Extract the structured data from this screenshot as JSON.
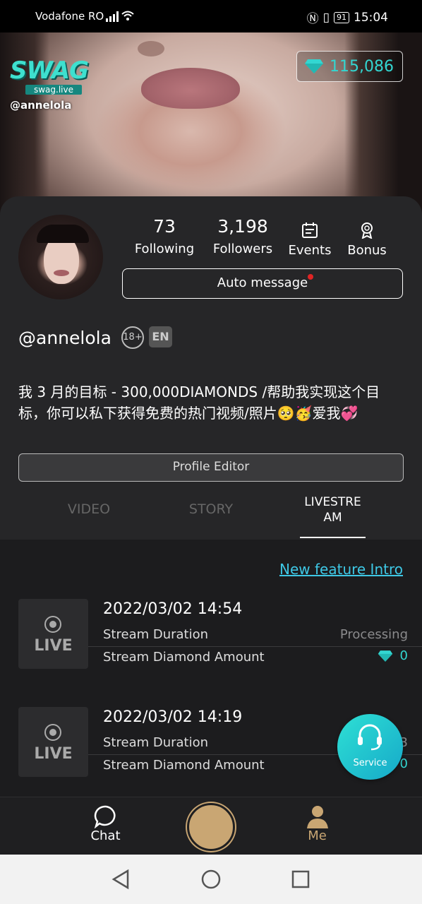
{
  "status_bar": {
    "carrier": "Vodafone RO",
    "battery": "91",
    "time": "15:04"
  },
  "hero": {
    "brand_logo": "SWAG",
    "brand_site": "swag.live",
    "handle": "@annelola",
    "diamond_balance": "115,086"
  },
  "profile": {
    "stats": [
      {
        "value": "73",
        "label": "Following"
      },
      {
        "value": "3,198",
        "label": "Followers"
      },
      {
        "value": "",
        "label": "Events",
        "icon": "calendar-icon"
      },
      {
        "value": "",
        "label": "Bonus",
        "icon": "badge-icon"
      }
    ],
    "auto_message_label": "Auto message",
    "username": "@annelola",
    "age_badge": "18+",
    "language_badge": "EN",
    "bio": "我 3 月的目标 - 300,000DIAMONDS /帮助我实现这个目标，你可以私下获得免费的热门视频/照片🥺🥳爱我💞",
    "profile_editor_label": "Profile Editor"
  },
  "tabs": [
    {
      "label": "VIDEO",
      "active": false
    },
    {
      "label": "STORY",
      "active": false
    },
    {
      "label": "LIVESTRE AM",
      "active": true
    }
  ],
  "list": {
    "feature_link": "New feature Intro",
    "streams": [
      {
        "tile_label": "LIVE",
        "date": "2022/03/02 14:54",
        "duration_label": "Stream Duration",
        "diamond_label": "Stream Diamond Amount",
        "status": "Processing",
        "diamonds": "0"
      },
      {
        "tile_label": "LIVE",
        "date": "2022/03/02 14:19",
        "duration_label": "Stream Duration",
        "diamond_label": "Stream Diamond Amount",
        "status": "3",
        "diamonds": "0"
      }
    ]
  },
  "service_label": "Service",
  "bottom_nav": {
    "chat_label": "Chat",
    "me_label": "Me"
  },
  "colors": {
    "accent_teal": "#33d6d1",
    "accent_gold": "#c9a673",
    "link": "#3ec8e6",
    "notification_dot": "#e02424"
  }
}
